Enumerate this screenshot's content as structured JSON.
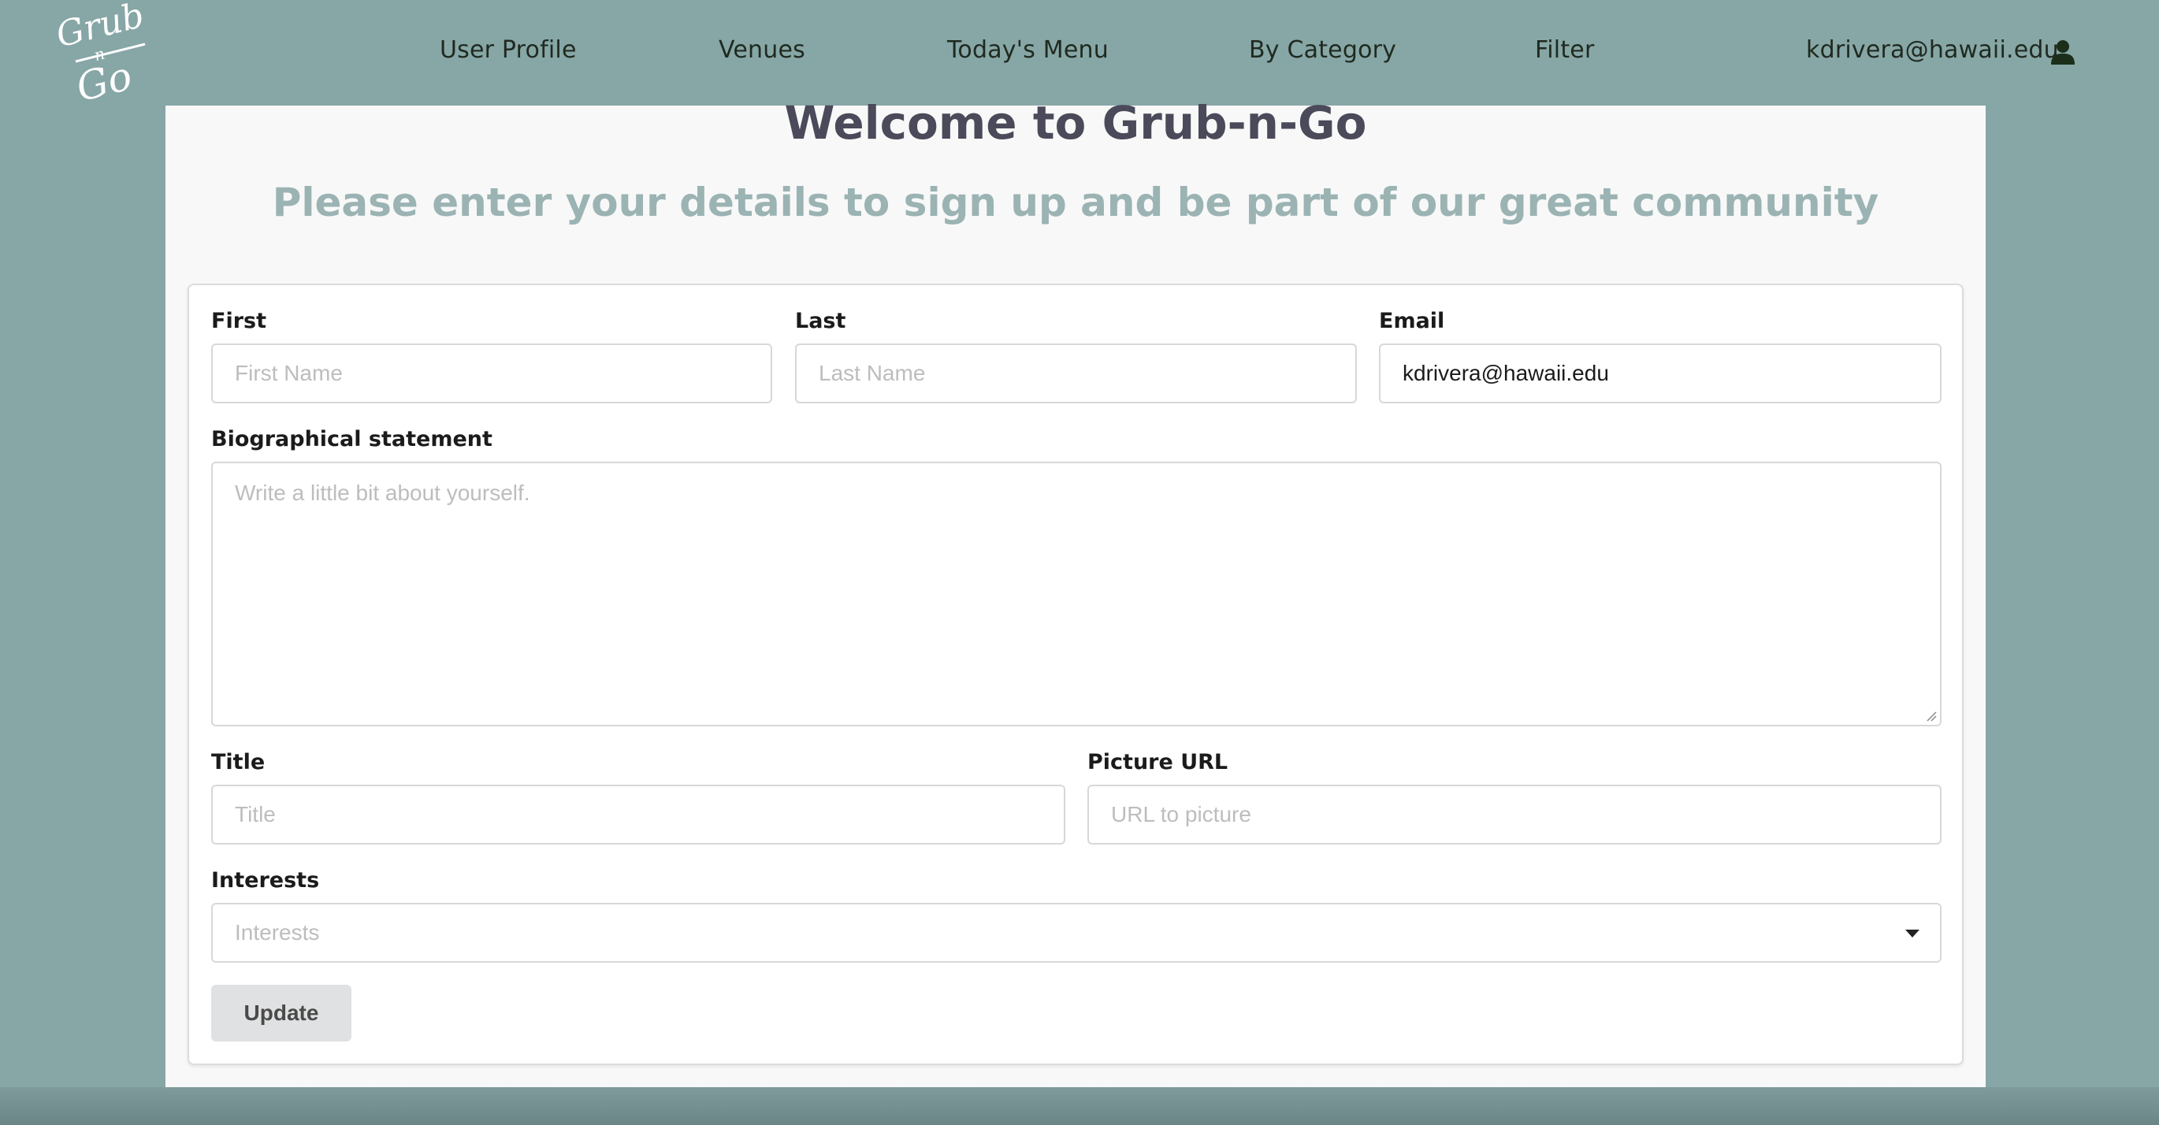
{
  "nav": {
    "logo_text": "Grub n Go",
    "items": [
      {
        "label": "User Profile"
      },
      {
        "label": "Venues"
      },
      {
        "label": "Today's Menu"
      },
      {
        "label": "By Category"
      },
      {
        "label": "Filter"
      }
    ],
    "user_email": "kdrivera@hawaii.edu",
    "user_icon": "user-icon"
  },
  "header": {
    "title": "Welcome to Grub-n-Go",
    "subtitle": "Please enter your details to sign up and be part of our great community"
  },
  "form": {
    "first": {
      "label": "First",
      "placeholder": "First Name",
      "value": ""
    },
    "last": {
      "label": "Last",
      "placeholder": "Last Name",
      "value": ""
    },
    "email": {
      "label": "Email",
      "placeholder": "",
      "value": "kdrivera@hawaii.edu"
    },
    "bio": {
      "label": "Biographical statement",
      "placeholder": "Write a little bit about yourself."
    },
    "title": {
      "label": "Title",
      "placeholder": "Title"
    },
    "picture": {
      "label": "Picture URL",
      "placeholder": "URL to picture"
    },
    "interests": {
      "label": "Interests",
      "placeholder": "Interests"
    },
    "submit_label": "Update"
  },
  "colors": {
    "background": "#87a6a6",
    "page": "#f8f8f8",
    "title": "#4a4a5a",
    "subtitle": "#9bb3b3",
    "button": "#e0e1e2"
  }
}
